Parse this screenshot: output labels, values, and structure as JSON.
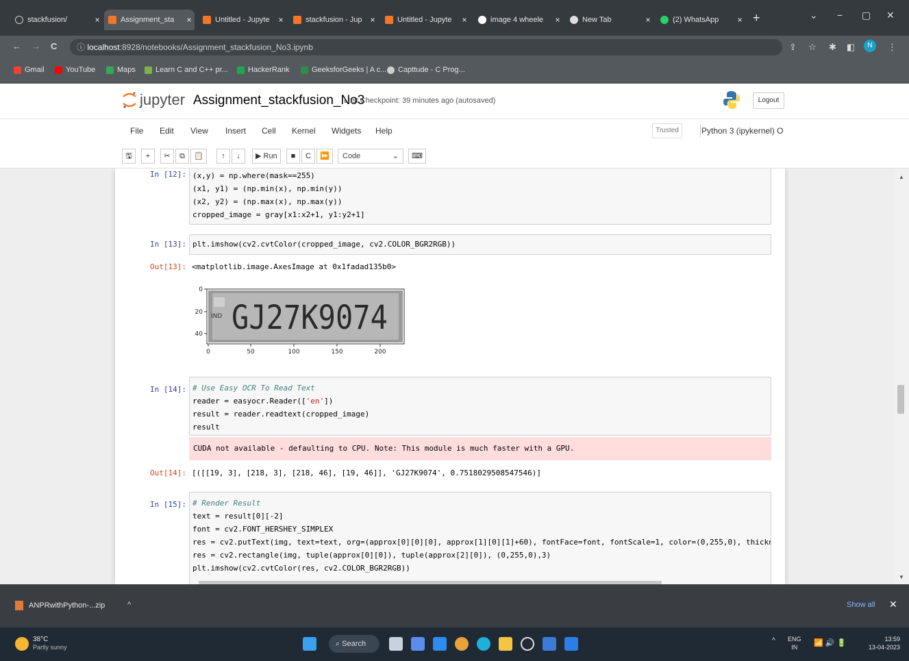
{
  "browser": {
    "tabs": [
      {
        "title": "stackfusion/",
        "active": false
      },
      {
        "title": "Assignment_sta",
        "active": true
      },
      {
        "title": "Untitled - Jupyte",
        "active": false
      },
      {
        "title": "stackfusion - Jup",
        "active": false
      },
      {
        "title": "Untitled - Jupyte",
        "active": false
      },
      {
        "title": "image 4 wheele",
        "active": false
      },
      {
        "title": "New Tab",
        "active": false
      },
      {
        "title": "(2) WhatsApp",
        "active": false
      }
    ],
    "tab_close": "×",
    "new_tab": "+",
    "window": {
      "menu": "⌄",
      "minimize": "−",
      "maximize": "▢",
      "close": "✕"
    },
    "nav": {
      "back": "←",
      "forward": "→",
      "reload": "C"
    },
    "url": {
      "host": "localhost",
      "rest": ":8928/notebooks/Assignment_stackfusion_No3.ipynb"
    },
    "profile_initial": "N",
    "bookmarks": [
      "Gmail",
      "YouTube",
      "Maps",
      "Learn C and C++ pr...",
      "HackerRank",
      "GeeksforGeeks | A c...",
      "Capttude - C Prog..."
    ]
  },
  "jupyter": {
    "logo_text": "jupyter",
    "notebook_name": "Assignment_stackfusion_No3",
    "checkpoint": "Last Checkpoint: 39 minutes ago  (autosaved)",
    "logout": "Logout",
    "menu": [
      "File",
      "Edit",
      "View",
      "Insert",
      "Cell",
      "Kernel",
      "Widgets",
      "Help"
    ],
    "trusted": "Trusted",
    "kernel": "Python 3 (ipykernel)",
    "kernel_indicator": "O",
    "toolbar": {
      "buttons": [
        "🖫",
        "+",
        "✂",
        "⧉",
        "📋",
        "↑",
        "↓"
      ],
      "run": "▶ Run",
      "stop": "■",
      "restart": "C",
      "restart_run": "⏩",
      "cell_type": "Code",
      "keyboard": "⌨"
    }
  },
  "cells": {
    "c12": {
      "prompt": "In [12]:",
      "lines": [
        "(x,y) = np.where(mask==255)",
        "(x1, y1) = (np.min(x), np.min(y))",
        "(x2, y2) = (np.max(x), np.max(y))",
        "cropped_image = gray[x1:x2+1, y1:y2+1]"
      ]
    },
    "c13": {
      "prompt": "In [13]:",
      "code": "plt.imshow(cv2.cvtColor(cropped_image, cv2.COLOR_BGR2RGB))",
      "out_prompt": "Out[13]:",
      "out_text": "<matplotlib.image.AxesImage at 0x1fadad135b0>",
      "plate_text": "GJ27K9074",
      "plate_ind": "IND",
      "y_ticks": [
        "0",
        "20",
        "40"
      ],
      "x_ticks": [
        "0",
        "50",
        "100",
        "150",
        "200"
      ]
    },
    "c14": {
      "prompt": "In [14]:",
      "comment": "# Use Easy OCR To Read Text",
      "l2a": "reader = easyocr.Reader([",
      "l2b": "'en'",
      "l2c": "])",
      "l3": "result = reader.readtext(cropped_image)",
      "l4": "result",
      "stderr": "CUDA not available - defaulting to CPU. Note: This module is much faster with a GPU.",
      "out_prompt": "Out[14]:",
      "out_text": "[([[19, 3], [218, 3], [218, 46], [19, 46]], 'GJ27K9074', 0.7518029508547546)]"
    },
    "c15": {
      "prompt": "In [15]:",
      "comment": "# Render Result",
      "lines": [
        "text = result[0][-2]",
        "font = cv2.FONT_HERSHEY_SIMPLEX",
        "res = cv2.putText(img, text=text, org=(approx[0][0][0], approx[1][0][1]+60), fontFace=font, fontScale=1, color=(0,255,0), thickne",
        "res = cv2.rectangle(img, tuple(approx[0][0]), tuple(approx[2][0]), (0,255,0),3)",
        "plt.imshow(cv2.cvtColor(res, cv2.COLOR_BGR2RGB))"
      ]
    }
  },
  "downloads": {
    "file": "ANPRwithPython-...zip",
    "chevron": "^",
    "show_all": "Show all",
    "close": "✕"
  },
  "taskbar": {
    "temp": "38°C",
    "weather": "Partly sunny",
    "search": "Search",
    "lang_top": "ENG",
    "lang_bottom": "IN",
    "time": "13:59",
    "date": "13-04-2023",
    "tray_chevron": "^",
    "tray_icons": "📶 🔊 🔋"
  },
  "colors": {
    "accent": "#f37726",
    "chrome_dark": "#353a3f",
    "stderr_bg": "#ffdddd"
  }
}
